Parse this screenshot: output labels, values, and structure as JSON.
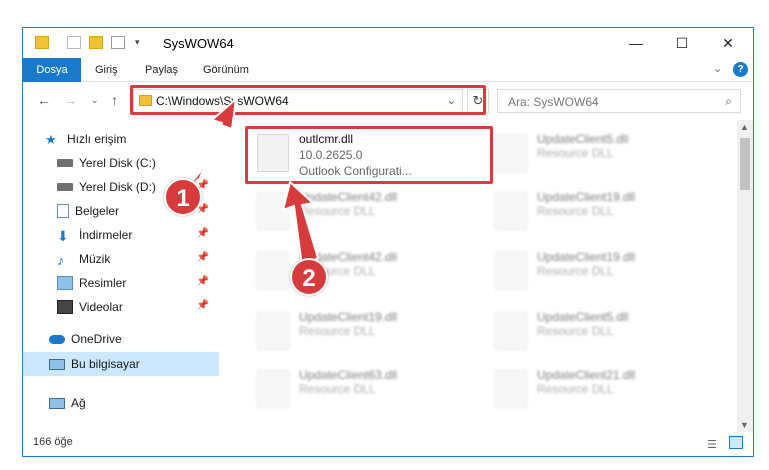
{
  "window": {
    "title": "SysWOW64",
    "controls": [
      "—",
      "☐",
      "✕"
    ],
    "accent": "#1979ca"
  },
  "ribbon": {
    "tabs": [
      "Dosya",
      "Giriş",
      "Paylaş",
      "Görünüm"
    ],
    "active_tab": "Dosya"
  },
  "address": {
    "path": "C:\\Windows\\SysWOW64",
    "search_placeholder": "Ara: SysWOW64"
  },
  "sidebar": {
    "items": [
      {
        "label": "Hızlı erişim",
        "icon": "star-icon",
        "pinned": false,
        "selected": false
      },
      {
        "label": "Yerel Disk (C:)",
        "icon": "drive-icon",
        "pinned": false,
        "selected": false
      },
      {
        "label": "Yerel Disk (D:)",
        "icon": "drive-icon",
        "pinned": true,
        "selected": false
      },
      {
        "label": "Belgeler",
        "icon": "documents-icon",
        "pinned": true,
        "selected": false
      },
      {
        "label": "İndirmeler",
        "icon": "download-icon",
        "pinned": true,
        "selected": false
      },
      {
        "label": "Müzik",
        "icon": "music-icon",
        "pinned": true,
        "selected": false
      },
      {
        "label": "Resimler",
        "icon": "pictures-icon",
        "pinned": true,
        "selected": false
      },
      {
        "label": "Videolar",
        "icon": "videos-icon",
        "pinned": true,
        "selected": false
      },
      {
        "label": "OneDrive",
        "icon": "cloud-icon",
        "pinned": false,
        "selected": false
      },
      {
        "label": "Bu bilgisayar",
        "icon": "computer-icon",
        "pinned": false,
        "selected": true
      },
      {
        "label": "Ağ",
        "icon": "network-icon",
        "pinned": false,
        "selected": false
      }
    ]
  },
  "files": [
    {
      "name": "outlcmr.dll",
      "version": "10.0.2625.0",
      "desc": "Outlook Configurati...",
      "highlighted": true
    },
    {
      "name": "UpdateClient5.dll",
      "desc": "Resource DLL"
    },
    {
      "name": "UpdateClient42.dll",
      "desc": "Resource DLL"
    },
    {
      "name": "UpdateClient19.dll",
      "desc": "Resource DLL"
    },
    {
      "name": "UpdateClient42.dll",
      "desc": "Resource DLL"
    },
    {
      "name": "UpdateClient19.dll",
      "desc": "Resource DLL"
    },
    {
      "name": "UpdateClient19.dll",
      "desc": "Resource DLL"
    },
    {
      "name": "UpdateClient5.dll",
      "desc": "Resource DLL"
    },
    {
      "name": "UpdateClient63.dll",
      "desc": "Resource DLL"
    },
    {
      "name": "UpdateClient21.dll",
      "desc": "Resource DLL"
    }
  ],
  "status": {
    "count": "166 öğe"
  },
  "callouts": [
    "1",
    "2"
  ],
  "colors": {
    "highlight": "#d83b3b",
    "selected": "#cce8ff"
  }
}
